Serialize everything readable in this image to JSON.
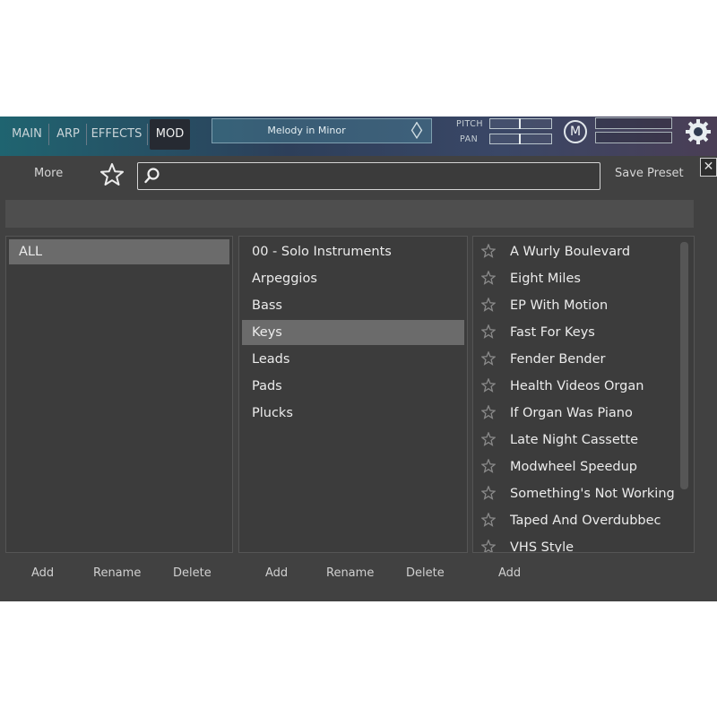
{
  "tabs": [
    "MAIN",
    "ARP",
    "EFFECTS",
    "MOD"
  ],
  "active_tab": "MOD",
  "preset_display": {
    "name": "Melody in Minor",
    "prev_glyph": "〈",
    "next_glyph": "〉"
  },
  "controls": {
    "pitch_label": "PITCH",
    "pan_label": "PAN",
    "m_button": "M"
  },
  "browser": {
    "more_label": "More",
    "search_placeholder": "",
    "search_value": "",
    "save_preset_label": "Save Preset",
    "close_glyph": "✕"
  },
  "banks": {
    "items": [
      "ALL"
    ],
    "selected": "ALL"
  },
  "categories": {
    "items": [
      "00 - Solo Instruments",
      "Arpeggios",
      "Bass",
      "Keys",
      "Leads",
      "Pads",
      "Plucks"
    ],
    "selected": "Keys"
  },
  "presets": {
    "items": [
      "A Wurly Boulevard",
      "Eight Miles",
      "EP With Motion",
      "Fast For Keys",
      "Fender Bender",
      "Health Videos Organ",
      "If Organ Was Piano",
      "Late Night Cassette",
      "Modwheel Speedup",
      "Something's Not Working",
      "Taped And Overdubbec",
      "VHS Style"
    ]
  },
  "actions": {
    "banks": [
      "Add",
      "Rename",
      "Delete"
    ],
    "categories": [
      "Add",
      "Rename",
      "Delete"
    ],
    "presets": [
      "Add"
    ]
  },
  "icons": {
    "favorite_filter": "star-outline-icon",
    "search": "magnifier-icon",
    "settings": "gear-icon",
    "preset_favorite": "star-outline-icon"
  },
  "colors": {
    "background": "#414141",
    "panel": "#3c3c3c",
    "selected_row": "#6b6b6b",
    "header_left": "#1f6470",
    "header_right": "#4a3e55"
  }
}
